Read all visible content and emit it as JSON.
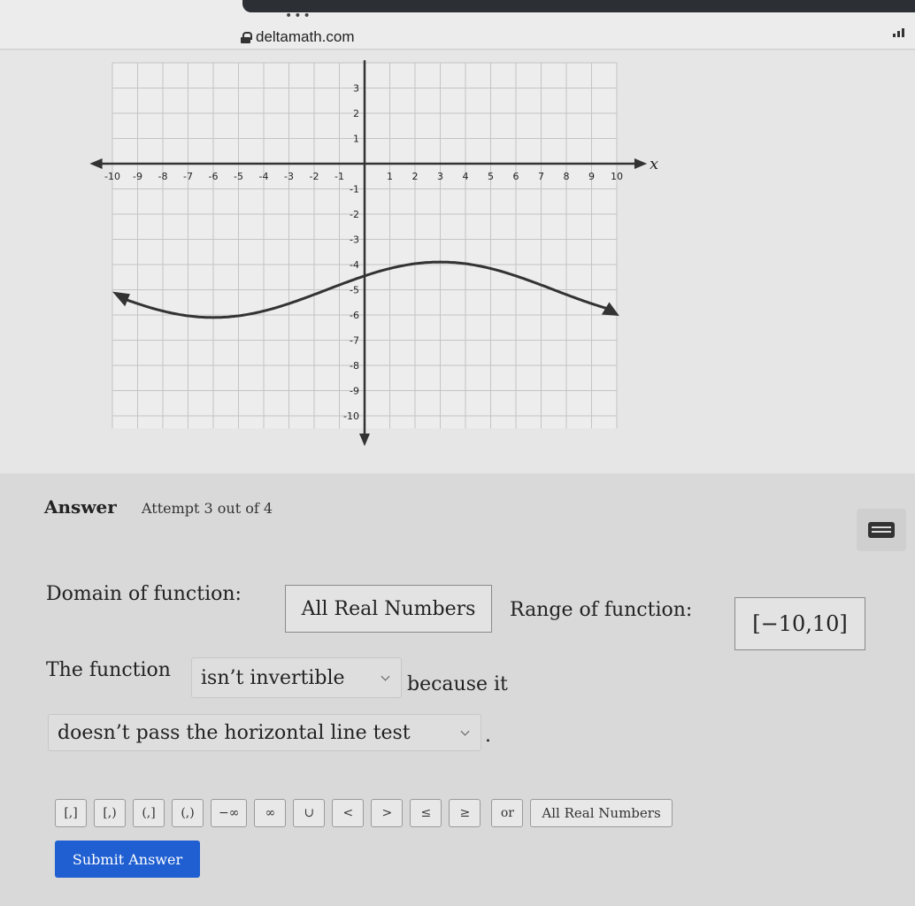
{
  "browser": {
    "dots": "•••",
    "url": "deltamath.com"
  },
  "graph": {
    "x_axis_label": "x",
    "x_tick_labels": [
      "-10",
      "-9",
      "-8",
      "-7",
      "-6",
      "-5",
      "-4",
      "-3",
      "-2",
      "-1",
      "1",
      "2",
      "3",
      "4",
      "5",
      "6",
      "7",
      "8",
      "9",
      "10"
    ],
    "y_tick_labels": [
      "3",
      "2",
      "1",
      "-1",
      "-2",
      "-3",
      "-4",
      "-5",
      "-6",
      "-7",
      "-8",
      "-9",
      "-10"
    ],
    "curve_color": "#333333"
  },
  "answer": {
    "title": "Answer",
    "attempt": "Attempt 3 out of 4",
    "domain_label": "Domain of function:",
    "domain_value": "All Real Numbers",
    "range_label": "Range of function:",
    "range_value": "[−10,10]",
    "sentence_start": "The function",
    "invertible_selected": "isn’t invertible",
    "because_text": "because it",
    "reason_selected": "doesn’t pass the horizontal line test",
    "period": "."
  },
  "toolbar": {
    "buttons": [
      "[,]",
      "[,)",
      "(,]",
      "(,)",
      "−∞",
      "∞",
      "∪",
      "<",
      ">",
      "≤",
      "≥",
      "or",
      "All Real Numbers"
    ]
  },
  "submit_label": "Submit Answer",
  "colors": {
    "submit_bg": "#1f5fd1",
    "panel_bg": "#d9d9d9"
  }
}
